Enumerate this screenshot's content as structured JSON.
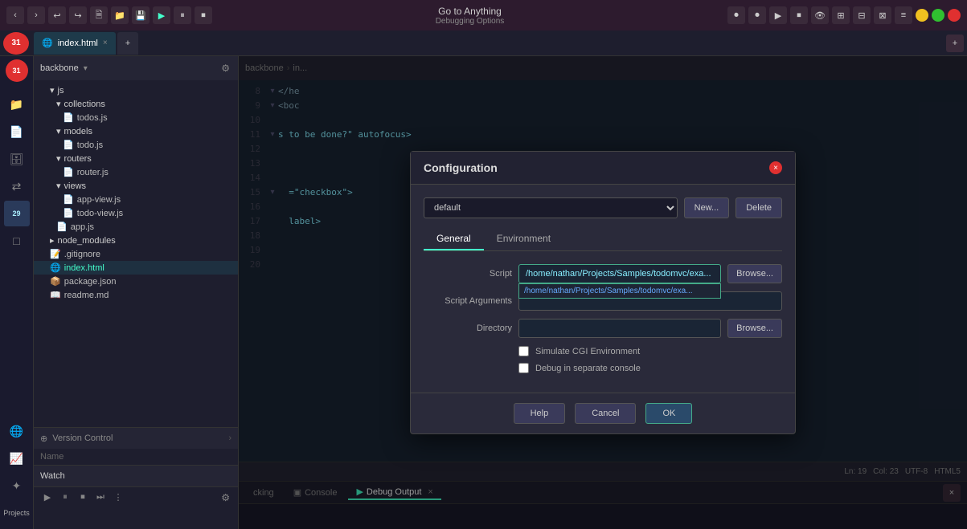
{
  "app": {
    "title": "Go to Anything",
    "subtitle": "Debugging Options"
  },
  "titlebar": {
    "tabs": [
      {
        "label": "index.html",
        "active": true,
        "icon": "🌐"
      },
      {
        "label": "+",
        "active": false,
        "icon": ""
      }
    ],
    "buttons": {
      "back": "‹",
      "forward": "›",
      "undo": "↩",
      "redo": "↪",
      "open_file": "📄",
      "open_folder": "📁",
      "save": "💾",
      "run": "▶",
      "pause": "⏸",
      "stop": "⏹",
      "info": "ℹ"
    },
    "window_controls": {
      "minimize": "−",
      "maximize": "+",
      "close": "×"
    }
  },
  "sidebar": {
    "icons": [
      {
        "name": "sidebar-icon-logo",
        "symbol": "31",
        "badge": null
      },
      {
        "name": "sidebar-icon-files",
        "symbol": "📁",
        "badge": null
      },
      {
        "name": "sidebar-icon-new",
        "symbol": "📄",
        "badge": null
      },
      {
        "name": "sidebar-icon-db",
        "symbol": "🗄",
        "badge": null
      },
      {
        "name": "sidebar-icon-sync",
        "symbol": "⇄",
        "badge": null
      },
      {
        "name": "sidebar-icon-git",
        "symbol": "⎇",
        "badge": null
      },
      {
        "name": "sidebar-icon-badge",
        "symbol": "29",
        "badge": "29"
      },
      {
        "name": "sidebar-icon-square",
        "symbol": "□",
        "badge": null
      },
      {
        "name": "sidebar-icon-globe",
        "symbol": "🌐",
        "badge": null
      },
      {
        "name": "sidebar-icon-chart",
        "symbol": "📈",
        "badge": null
      },
      {
        "name": "sidebar-icon-star",
        "symbol": "✦",
        "badge": null
      }
    ]
  },
  "file_panel": {
    "header": {
      "label": "backbone",
      "caret": "▾"
    },
    "tree": [
      {
        "indent": 1,
        "type": "folder",
        "label": "js",
        "caret": "▾"
      },
      {
        "indent": 2,
        "type": "folder",
        "label": "collections",
        "caret": "▾"
      },
      {
        "indent": 3,
        "type": "file",
        "label": "todos.js",
        "icon": "📄"
      },
      {
        "indent": 2,
        "type": "folder",
        "label": "models",
        "caret": "▾"
      },
      {
        "indent": 3,
        "type": "file",
        "label": "todo.js",
        "icon": "📄"
      },
      {
        "indent": 2,
        "type": "folder",
        "label": "routers",
        "caret": "▾"
      },
      {
        "indent": 3,
        "type": "file",
        "label": "router.js",
        "icon": "📄"
      },
      {
        "indent": 2,
        "type": "folder",
        "label": "views",
        "caret": "▾"
      },
      {
        "indent": 3,
        "type": "file",
        "label": "app-view.js",
        "icon": "📄"
      },
      {
        "indent": 3,
        "type": "file",
        "label": "todo-view.js",
        "icon": "📄"
      },
      {
        "indent": 2,
        "type": "file",
        "label": "app.js",
        "icon": "📄"
      },
      {
        "indent": 1,
        "type": "folder",
        "label": "node_modules",
        "caret": "▸"
      },
      {
        "indent": 1,
        "type": "file",
        "label": ".gitignore",
        "icon": "📝"
      },
      {
        "indent": 1,
        "type": "file",
        "label": "index.html",
        "icon": "🌐"
      },
      {
        "indent": 1,
        "type": "file",
        "label": "package.json",
        "icon": "📦"
      },
      {
        "indent": 1,
        "type": "file",
        "label": "readme.md",
        "icon": "📖"
      }
    ]
  },
  "version_control": {
    "label": "Version Control",
    "columns": [
      {
        "label": "Name"
      }
    ]
  },
  "watch": {
    "label": "Watch"
  },
  "editor": {
    "breadcrumb": {
      "root": "backbone",
      "arrow": "›",
      "file": "in..."
    },
    "lines": [
      {
        "num": "8",
        "collapse": "▾",
        "content": "  </he"
      },
      {
        "num": "9",
        "collapse": "▾",
        "content": "  <boc"
      },
      {
        "num": "10",
        "collapse": "",
        "content": ""
      },
      {
        "num": "11",
        "collapse": "▾",
        "content": ""
      },
      {
        "num": "12",
        "collapse": "",
        "content": ""
      },
      {
        "num": "13",
        "collapse": "",
        "content": ""
      },
      {
        "num": "14",
        "collapse": "",
        "content": ""
      },
      {
        "num": "15",
        "collapse": "▾",
        "content": ""
      },
      {
        "num": "16",
        "collapse": "",
        "content": ""
      },
      {
        "num": "17",
        "collapse": "",
        "content": ""
      },
      {
        "num": "18",
        "collapse": "",
        "content": ""
      },
      {
        "num": "19",
        "collapse": "",
        "content": ""
      },
      {
        "num": "20",
        "collapse": "",
        "content": ""
      }
    ],
    "code_snippets": {
      "l8": "  </he",
      "l9": "  <boc",
      "l11_right": "s to be done?\" autofocus>",
      "l15_right": "  =\"checkbox\">",
      "l17_right": "  label>"
    },
    "status": {
      "ln": "Ln: 19",
      "col": "Col: 23",
      "encoding": "UTF-8",
      "syntax": "HTML5"
    }
  },
  "bottom_panel": {
    "tabs": [
      {
        "label": "cking",
        "active": false
      },
      {
        "label": "Console",
        "icon": "▣",
        "active": false
      },
      {
        "label": "Debug Output",
        "icon": "▶",
        "active": true
      }
    ]
  },
  "dialog": {
    "title": "Configuration",
    "close_btn": "×",
    "config_select": "default",
    "new_btn": "New...",
    "delete_btn": "Delete",
    "tabs": [
      {
        "label": "General",
        "active": true
      },
      {
        "label": "Environment",
        "active": false
      }
    ],
    "form": {
      "script_label": "Script",
      "script_value": "/home/nathan/Projects/Samples/todomvc/exa...",
      "script_dropdown_value": "/home/nathan/Projects/Samples/todomvc/exa...",
      "script_browse": "Browse...",
      "args_label": "Script Arguments",
      "args_value": "",
      "dir_label": "Directory",
      "dir_value": "",
      "dir_browse": "Browse...",
      "checkbox1_label": "Simulate CGI Environment",
      "checkbox2_label": "Debug in separate console"
    },
    "footer": {
      "help": "Help",
      "cancel": "Cancel",
      "ok": "OK"
    }
  }
}
